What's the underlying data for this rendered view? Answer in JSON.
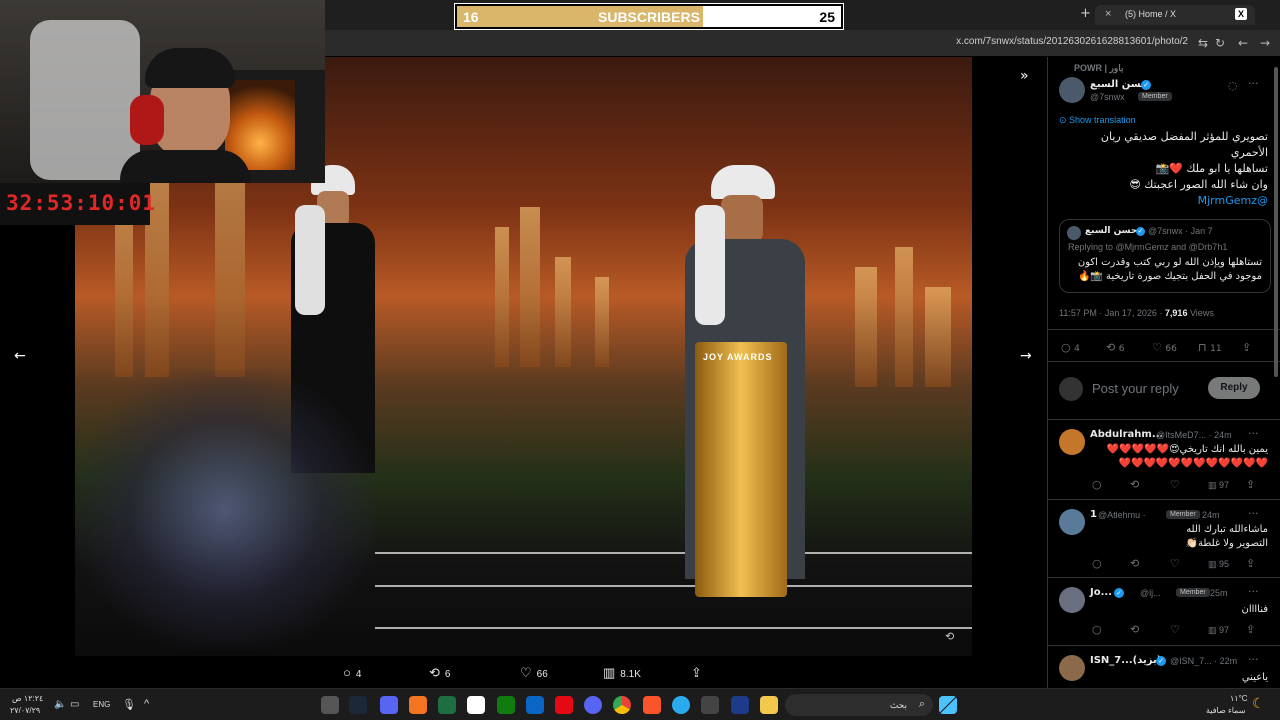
{
  "browser": {
    "tab_title": "(5) Home / X",
    "url": "x.com/7snwx/status/2012630261628813601/photo/2",
    "new_tab": "+",
    "tab_close": "×"
  },
  "subscriber_bar": {
    "left_value": "16",
    "label": "SUBSCRIBERS",
    "right_value": "25",
    "progress": 0.64
  },
  "timer": "32:53:10:01",
  "photo": {
    "podium_text": "JOY AWARDS",
    "prev_arrow": "←",
    "next_arrow": "→",
    "collapse_icon": "»"
  },
  "actions": {
    "replies": "4",
    "reposts": "6",
    "likes": "66",
    "views": "8.1K"
  },
  "tweet": {
    "context": "POWR | باور",
    "author": "حسن السبع",
    "handle": "@7snwx",
    "member_badge": "Member",
    "show_translation": "Show translation",
    "lines": [
      "تصويري للمؤثر المفضل صديقي ريان",
      "الأحمري",
      "تساهلها يا ابو ملك ❤️📸",
      "وان شاء الله الصور اعجبتك 😎"
    ],
    "mention": "@MjrmGemz",
    "quote": {
      "author": "حسن السبع",
      "handle": "@7snwx · Jan 7",
      "replying_to": "Replying to @MjrmGemz and @Drb7h1",
      "text1": "تستاهلها ويإذن الله لو ربي كتب وقدرت اكون",
      "text2": "موجود في الحفل بتجيك صورة تاريخية 📸🔥"
    },
    "timestamp": "11:57 PM · Jan 17, 2026 ·",
    "views_count": "7,916",
    "views_label": "Views",
    "stats": {
      "replies": "4",
      "reposts": "6",
      "likes": "66",
      "bookmarks": "11"
    },
    "reply_placeholder": "Post your reply",
    "reply_button": "Reply"
  },
  "replies": [
    {
      "name": "Abdulrahm...",
      "handle": "@ItsMeD7... · 24m",
      "text1": "يمين بالله انك تاريخي😍❤️❤️❤️❤️❤️",
      "text2": "❤️❤️❤️❤️❤️❤️❤️❤️❤️❤️❤️❤️",
      "views": "97"
    },
    {
      "name": "1",
      "handle": "@Atlehmu ·",
      "badge": "Member",
      "time": "24m",
      "text1": "ماشاءالله تبارك الله",
      "text2": "التصوير ولا غلطة👏🏻",
      "views": "95"
    },
    {
      "name": "Jo...",
      "handle": "@lj...",
      "badge": "Member",
      "time": "25m",
      "text1": "فناااان",
      "views": "97"
    },
    {
      "name": "ISN_7...(بزيد)",
      "handle": "@ISN_7... · 22m",
      "text1": "ياعيني"
    }
  ],
  "taskbar": {
    "time": "١٢:٢٤ ص",
    "date": "٢٧/٠٧/٢٩",
    "lang": "ENG",
    "search_placeholder": "بحث",
    "weather_temp": "١١°C",
    "weather_desc": "سماء صافية"
  },
  "colors": {
    "accent": "#1d9bf0",
    "subscriber_fill": "#d9b66a",
    "timer": "#e02828",
    "like": "#f91880"
  }
}
